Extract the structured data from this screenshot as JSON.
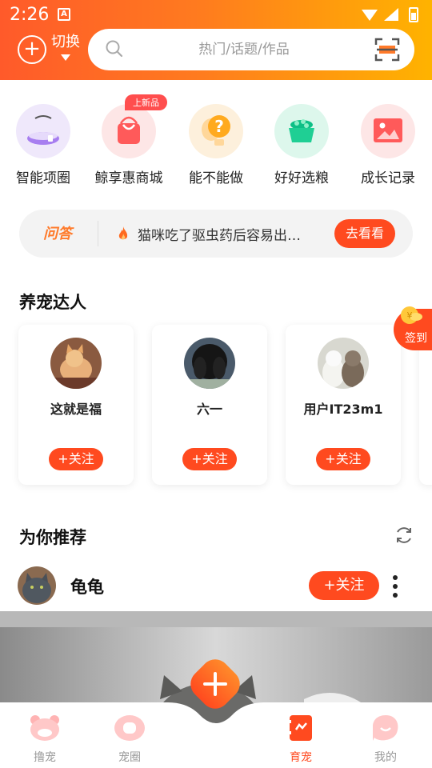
{
  "status_bar": {
    "time": "2:26",
    "notif_letter": "A"
  },
  "header": {
    "switch_label": "切换",
    "search_placeholder": "热门/话题/作品"
  },
  "quick_entries": [
    {
      "label": "智能项圈",
      "icon": "collar-icon"
    },
    {
      "label": "鲸享惠商城",
      "icon": "shopping-bag-icon",
      "badge": "上新品"
    },
    {
      "label": "能不能做",
      "icon": "question-bulb-icon"
    },
    {
      "label": "好好选粮",
      "icon": "food-bowl-icon"
    },
    {
      "label": "成长记录",
      "icon": "photo-album-icon"
    }
  ],
  "qa_bar": {
    "logo": "问答",
    "text": "猫咪吃了驱虫药后容易出…",
    "button": "去看看"
  },
  "experts": {
    "title": "养宠达人",
    "checkin": "签到",
    "cards": [
      {
        "name": "这就是福",
        "follow": "+关注"
      },
      {
        "name": "六一",
        "follow": "+关注"
      },
      {
        "name": "用户IT23m1",
        "follow": "+关注"
      }
    ]
  },
  "recommend": {
    "title": "为你推荐",
    "user": {
      "name": "龟龟",
      "follow": "+关注"
    }
  },
  "bottom_nav": [
    {
      "label": "撸宠",
      "active": false
    },
    {
      "label": "宠圈",
      "active": false
    },
    {
      "label": "育宠",
      "active": true
    },
    {
      "label": "我的",
      "active": false
    }
  ],
  "colors": {
    "accent": "#ff4a1f",
    "header_start": "#ff5a2a",
    "header_end": "#ffb300"
  }
}
